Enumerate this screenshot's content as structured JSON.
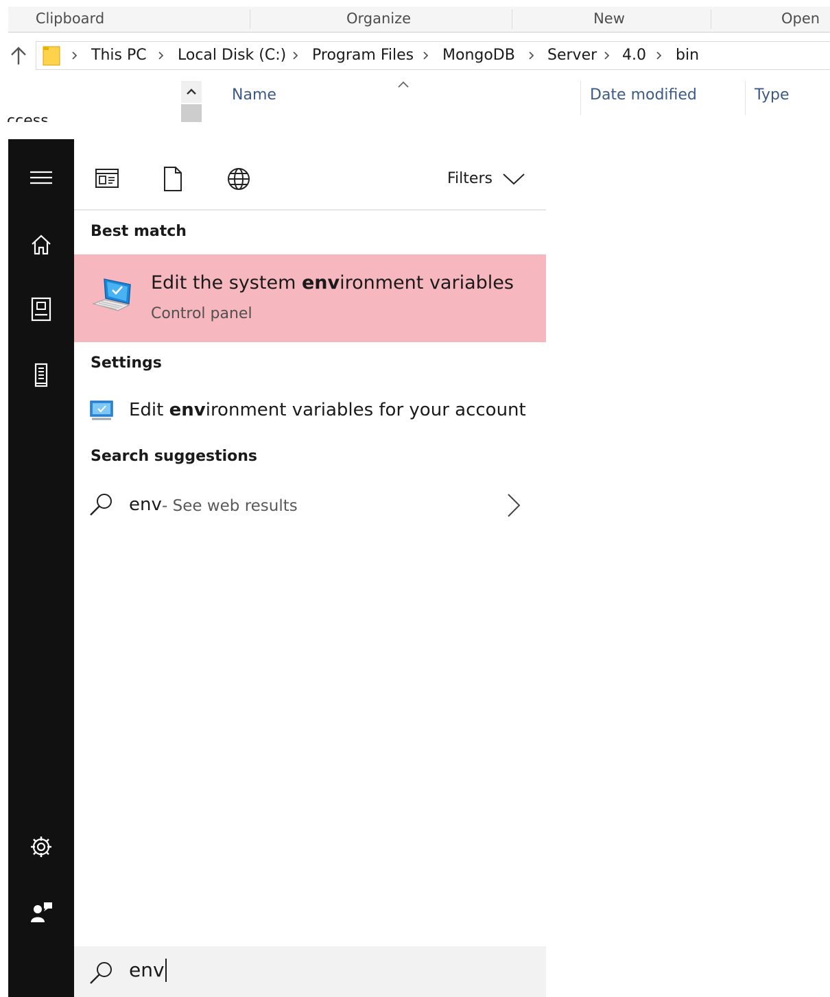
{
  "ribbon": {
    "groups": [
      "Clipboard",
      "Organize",
      "New",
      "Open"
    ]
  },
  "address": {
    "crumbs": [
      "This PC",
      "Local Disk (C:)",
      "Program Files",
      "MongoDB",
      "Server",
      "4.0",
      "bin"
    ]
  },
  "file_list": {
    "columns": [
      "Name",
      "Date modified",
      "Type"
    ],
    "nav_fragment": "ccess"
  },
  "start_menu": {
    "rail_icons": [
      "hamburger-icon",
      "home-icon",
      "contact-card-icon",
      "phone-tower-icon",
      "gear-icon",
      "user-feedback-icon"
    ],
    "filter_icons": [
      "apps-icon",
      "document-icon",
      "web-globe-icon"
    ],
    "filters_label": "Filters",
    "best_match": {
      "heading": "Best match",
      "title_before": "Edit the system ",
      "title_bold": "env",
      "title_after": "ironment variables",
      "subtitle": "Control panel",
      "highlight_color": "#f7b7bf"
    },
    "settings": {
      "heading": "Settings",
      "text_before": "Edit ",
      "text_bold": "env",
      "text_after": "ironment variables for your account"
    },
    "suggestions": {
      "heading": "Search suggestions",
      "query": "env",
      "hint": "- See web results"
    },
    "search": {
      "value": "env"
    }
  }
}
